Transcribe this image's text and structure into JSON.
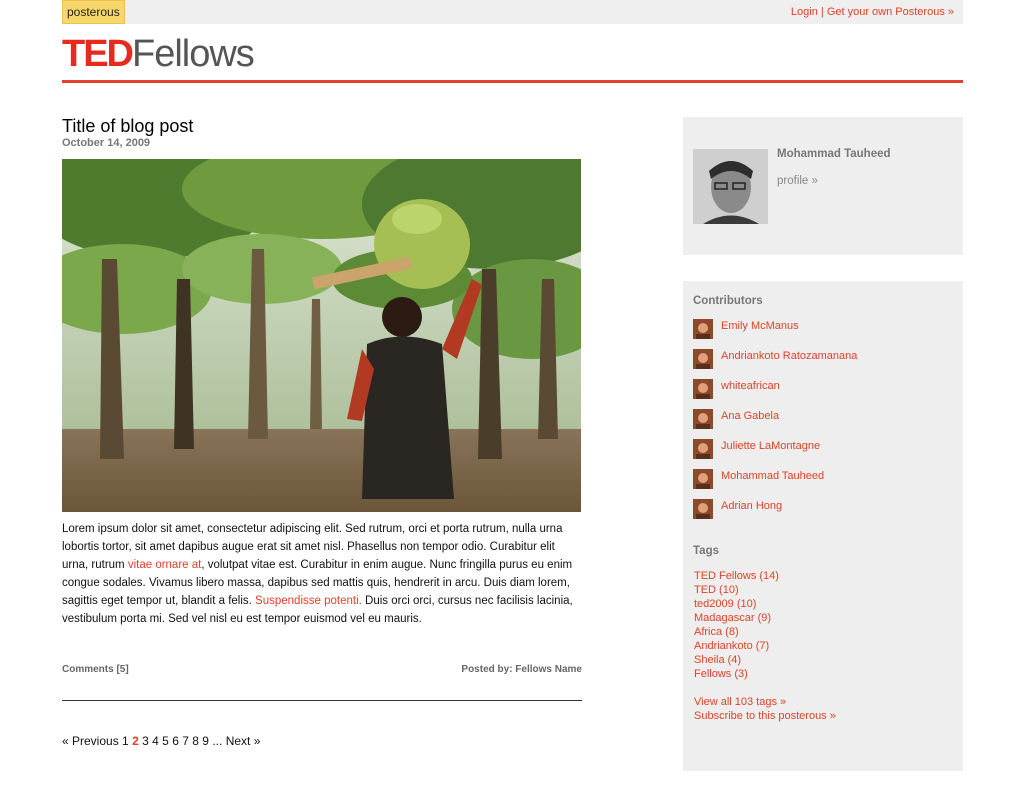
{
  "header": {
    "brand_tag": "posterous",
    "login_label": "Login",
    "separator": "|",
    "signup_label": "Get your own Posterous »",
    "logo_ted": "TED",
    "logo_fellows": "Fellows"
  },
  "post": {
    "title": "Title of blog post",
    "date": "October 14, 2009",
    "body": {
      "part1": "Lorem ipsum dolor sit amet, consectetur adipiscing elit. Sed rutrum, orci et porta rutrum, nulla urna lobortis tortor, sit amet dapibus augue erat sit amet nisl. Phasellus non tempor odio. Curabitur elit urna, rutrum ",
      "link1": "vitae ornare at",
      "part2": ", volutpat vitae est. Curabitur in enim augue. Nunc fringilla purus eu enim congue sodales. Vivamus libero massa, dapibus sed mattis quis, hendrerit in arcu. Duis diam lorem, sagittis eget tempor ut, blandit a felis. ",
      "link2": "Suspendisse potenti.",
      "part3": " Duis orci orci, cursus nec facilisis lacinia, vestibulum porta mi. Sed vel nisl eu est tempor euismod vel eu mauris."
    },
    "comments_label": "Comments [5]",
    "posted_by": "Posted by: Fellows Name"
  },
  "pager": {
    "previous": "« Previous",
    "pages": [
      "1",
      "2",
      "3",
      "4",
      "5",
      "6",
      "7",
      "8",
      "9"
    ],
    "current": "2",
    "ellipsis": "...",
    "next": "Next »"
  },
  "profile": {
    "name": "Mohammad Tauheed",
    "link": "profile »"
  },
  "sidebar": {
    "contributors_heading": "Contributors",
    "contributors": [
      "Emily McManus",
      "Andriankoto Ratozamanana",
      "whiteafrican",
      "Ana Gabela",
      "Juliette LaMontagne",
      "Mohammad Tauheed",
      "Adrian Hong"
    ],
    "tags_heading": "Tags",
    "tags": [
      "TED Fellows (14)",
      "TED (10)",
      "ted2009 (10)",
      "Madagascar (9)",
      "Africa (8)",
      "Andriankoto (7)",
      "Sheila (4)",
      "Fellows (3)"
    ],
    "view_all": "View all 103 tags »",
    "subscribe": "Subscribe to this posterous »"
  },
  "colors": {
    "accent": "#e2412a",
    "ted_red": "#e62b1e",
    "panel": "#eeeeee"
  }
}
